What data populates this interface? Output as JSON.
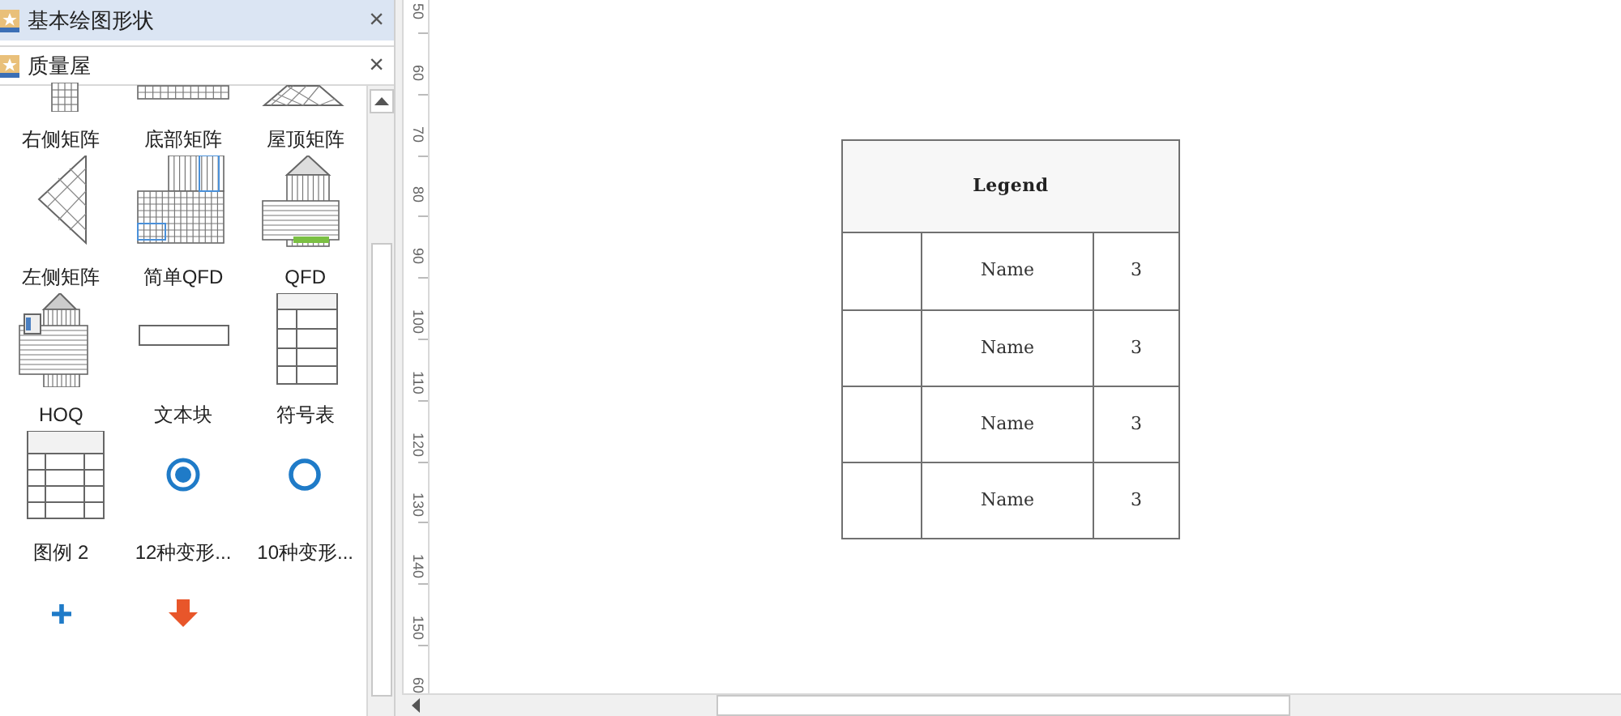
{
  "panels": [
    {
      "title": "基本绘图形状",
      "selected": true,
      "close": "×"
    },
    {
      "title": "质量屋",
      "selected": false,
      "close": "×"
    }
  ],
  "shapes": [
    {
      "kind": "right-matrix",
      "label": "右侧矩阵"
    },
    {
      "kind": "bottom-matrix",
      "label": "底部矩阵"
    },
    {
      "kind": "roof-matrix",
      "label": "屋顶矩阵"
    },
    {
      "kind": "left-matrix",
      "label": "左侧矩阵"
    },
    {
      "kind": "simple-qfd",
      "label": "简单QFD"
    },
    {
      "kind": "qfd",
      "label": "QFD"
    },
    {
      "kind": "hoq",
      "label": "HOQ"
    },
    {
      "kind": "text-block",
      "label": "文本块"
    },
    {
      "kind": "symbol-table",
      "label": "符号表"
    },
    {
      "kind": "legend-table",
      "label": "图例 2"
    },
    {
      "kind": "filled-ring",
      "label": "12种变形..."
    },
    {
      "kind": "ring",
      "label": "10种变形..."
    },
    {
      "kind": "plus"
    },
    {
      "kind": "down-arrow"
    }
  ],
  "ruler": [
    "50",
    "60",
    "70",
    "80",
    "90",
    "100",
    "110",
    "120",
    "130",
    "140",
    "150",
    "60"
  ],
  "legend": {
    "title": "Legend",
    "rows": [
      {
        "name": "Name",
        "value": "3"
      },
      {
        "name": "Name",
        "value": "3"
      },
      {
        "name": "Name",
        "value": "3"
      },
      {
        "name": "Name",
        "value": "3"
      }
    ]
  }
}
